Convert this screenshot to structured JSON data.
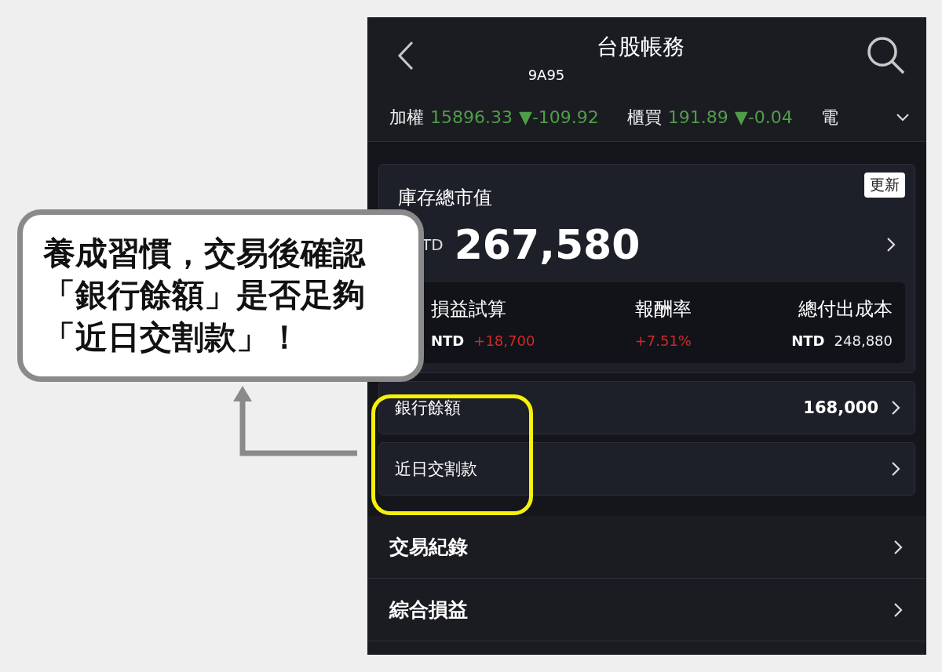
{
  "header": {
    "title": "台股帳務",
    "account": "9A95"
  },
  "indices": [
    {
      "name": "加權",
      "value": "15896.33",
      "change": "▼-109.92"
    },
    {
      "name": "櫃買",
      "value": "191.89",
      "change": "▼-0.04"
    },
    {
      "name": "電"
    }
  ],
  "market_value": {
    "label": "庫存總市值",
    "refresh_button": "更新",
    "currency": "TD",
    "amount": "267,580"
  },
  "summary": [
    {
      "label": "損益試算",
      "currency": "NTD",
      "value": "+18,700",
      "kind": "gain"
    },
    {
      "label": "報酬率",
      "value": "+7.51%",
      "kind": "gain"
    },
    {
      "label": "總付出成本",
      "currency": "NTD",
      "value": "248,880",
      "kind": "plain"
    }
  ],
  "balance_rows": [
    {
      "label": "銀行餘額",
      "value": "168,000"
    },
    {
      "label": "近日交割款"
    }
  ],
  "menu": [
    {
      "label": "交易紀錄"
    },
    {
      "label": "綜合損益"
    }
  ],
  "callout": {
    "text": "養成習慣，交易後確認「銀行餘額」是否足夠「近日交割款」！"
  }
}
